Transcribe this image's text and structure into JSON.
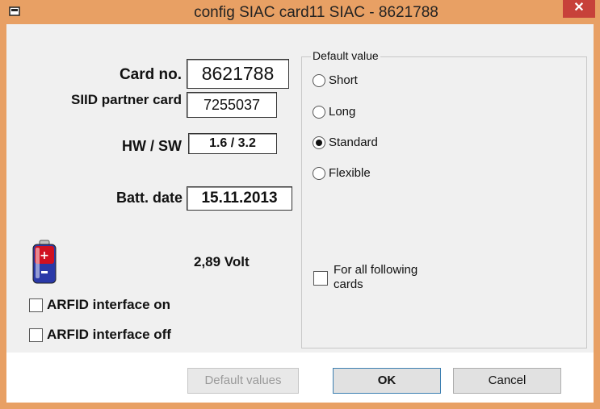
{
  "window": {
    "title": "config SIAC card11 SIAC - 8621788",
    "close_glyph": "✕",
    "title_icon": "card-icon"
  },
  "form": {
    "card_no_label": "Card no.",
    "card_no_value": "8621788",
    "siid_label": "SIID partner card",
    "siid_value": "7255037",
    "hwsw_label": "HW / SW",
    "hwsw_value": "1.6 / 3.2",
    "batt_label": "Batt. date",
    "batt_value": "15.11.2013",
    "voltage": "2,89 Volt",
    "battery_icon": "battery-icon",
    "arfid_on": {
      "label": "ARFID interface on",
      "checked": false
    },
    "arfid_off": {
      "label": "ARFID interface off",
      "checked": false
    }
  },
  "defaults": {
    "group_label": "Default value",
    "options": [
      {
        "label": "Short",
        "selected": false
      },
      {
        "label": "Long",
        "selected": false
      },
      {
        "label": "Standard",
        "selected": true
      },
      {
        "label": "Flexible",
        "selected": false
      }
    ],
    "for_all_line1": "For all following",
    "for_all_line2": "cards",
    "for_all_checked": false
  },
  "buttons": {
    "default_values": "Default values",
    "ok": "OK",
    "cancel": "Cancel"
  },
  "colors": {
    "titlebar": "#e8a064",
    "close": "#c7413a",
    "battery_body": "#2a39a8",
    "battery_top": "#d01020"
  }
}
